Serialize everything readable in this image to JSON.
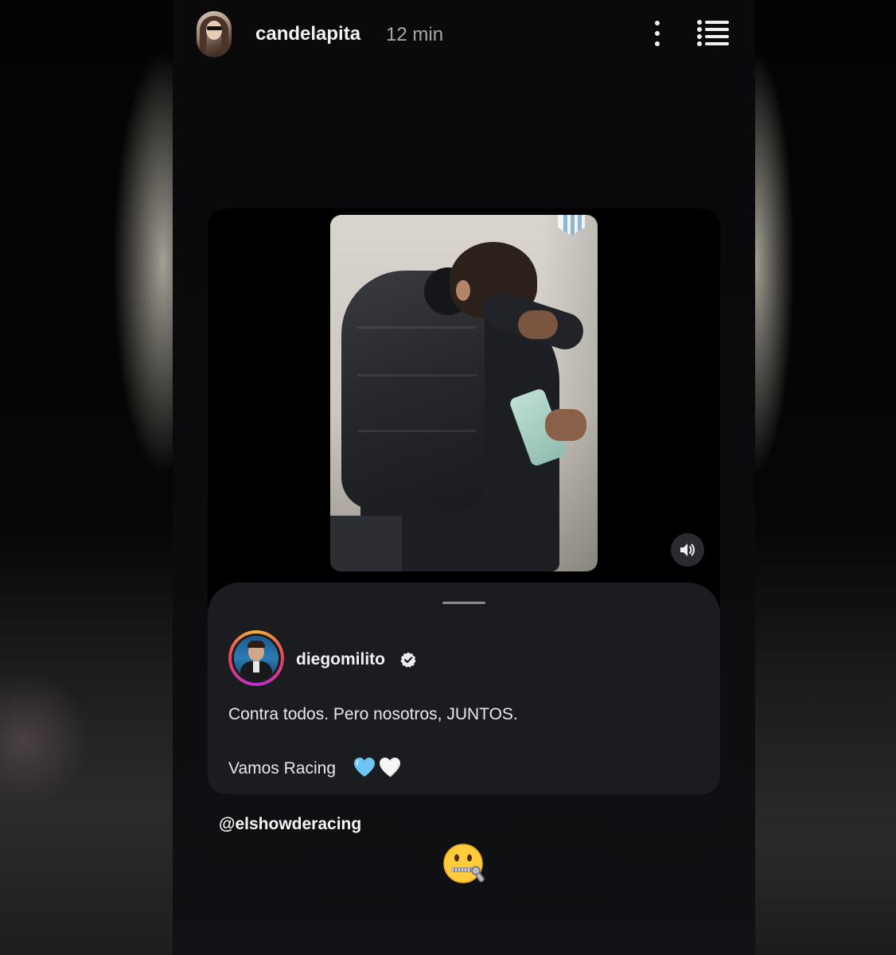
{
  "story": {
    "username": "candelapita",
    "time_ago": "12 min",
    "more_icon": "more-vertical-icon",
    "menu_icon": "list-menu-icon",
    "mention": "@elshowderacing",
    "sticker_emoji": "zipper-mouth-face"
  },
  "shared_post": {
    "author": "diegomilito",
    "verified": true,
    "caption_line1": "Contra todos. Pero nosotros, JUNTOS.",
    "caption_line2": "Vamos Racing",
    "caption_emojis": [
      "light-blue-heart",
      "white-heart"
    ],
    "volume_icon": "speaker-volume-icon",
    "media": "video-two-men-hugging"
  },
  "colors": {
    "background": "#0b0b0d",
    "card": "#1b1c20",
    "text_primary": "#f0f0f0",
    "text_secondary": "#a9a9ad",
    "light_blue_heart": "#6cc6f1",
    "white_heart": "#f5f5f5"
  }
}
